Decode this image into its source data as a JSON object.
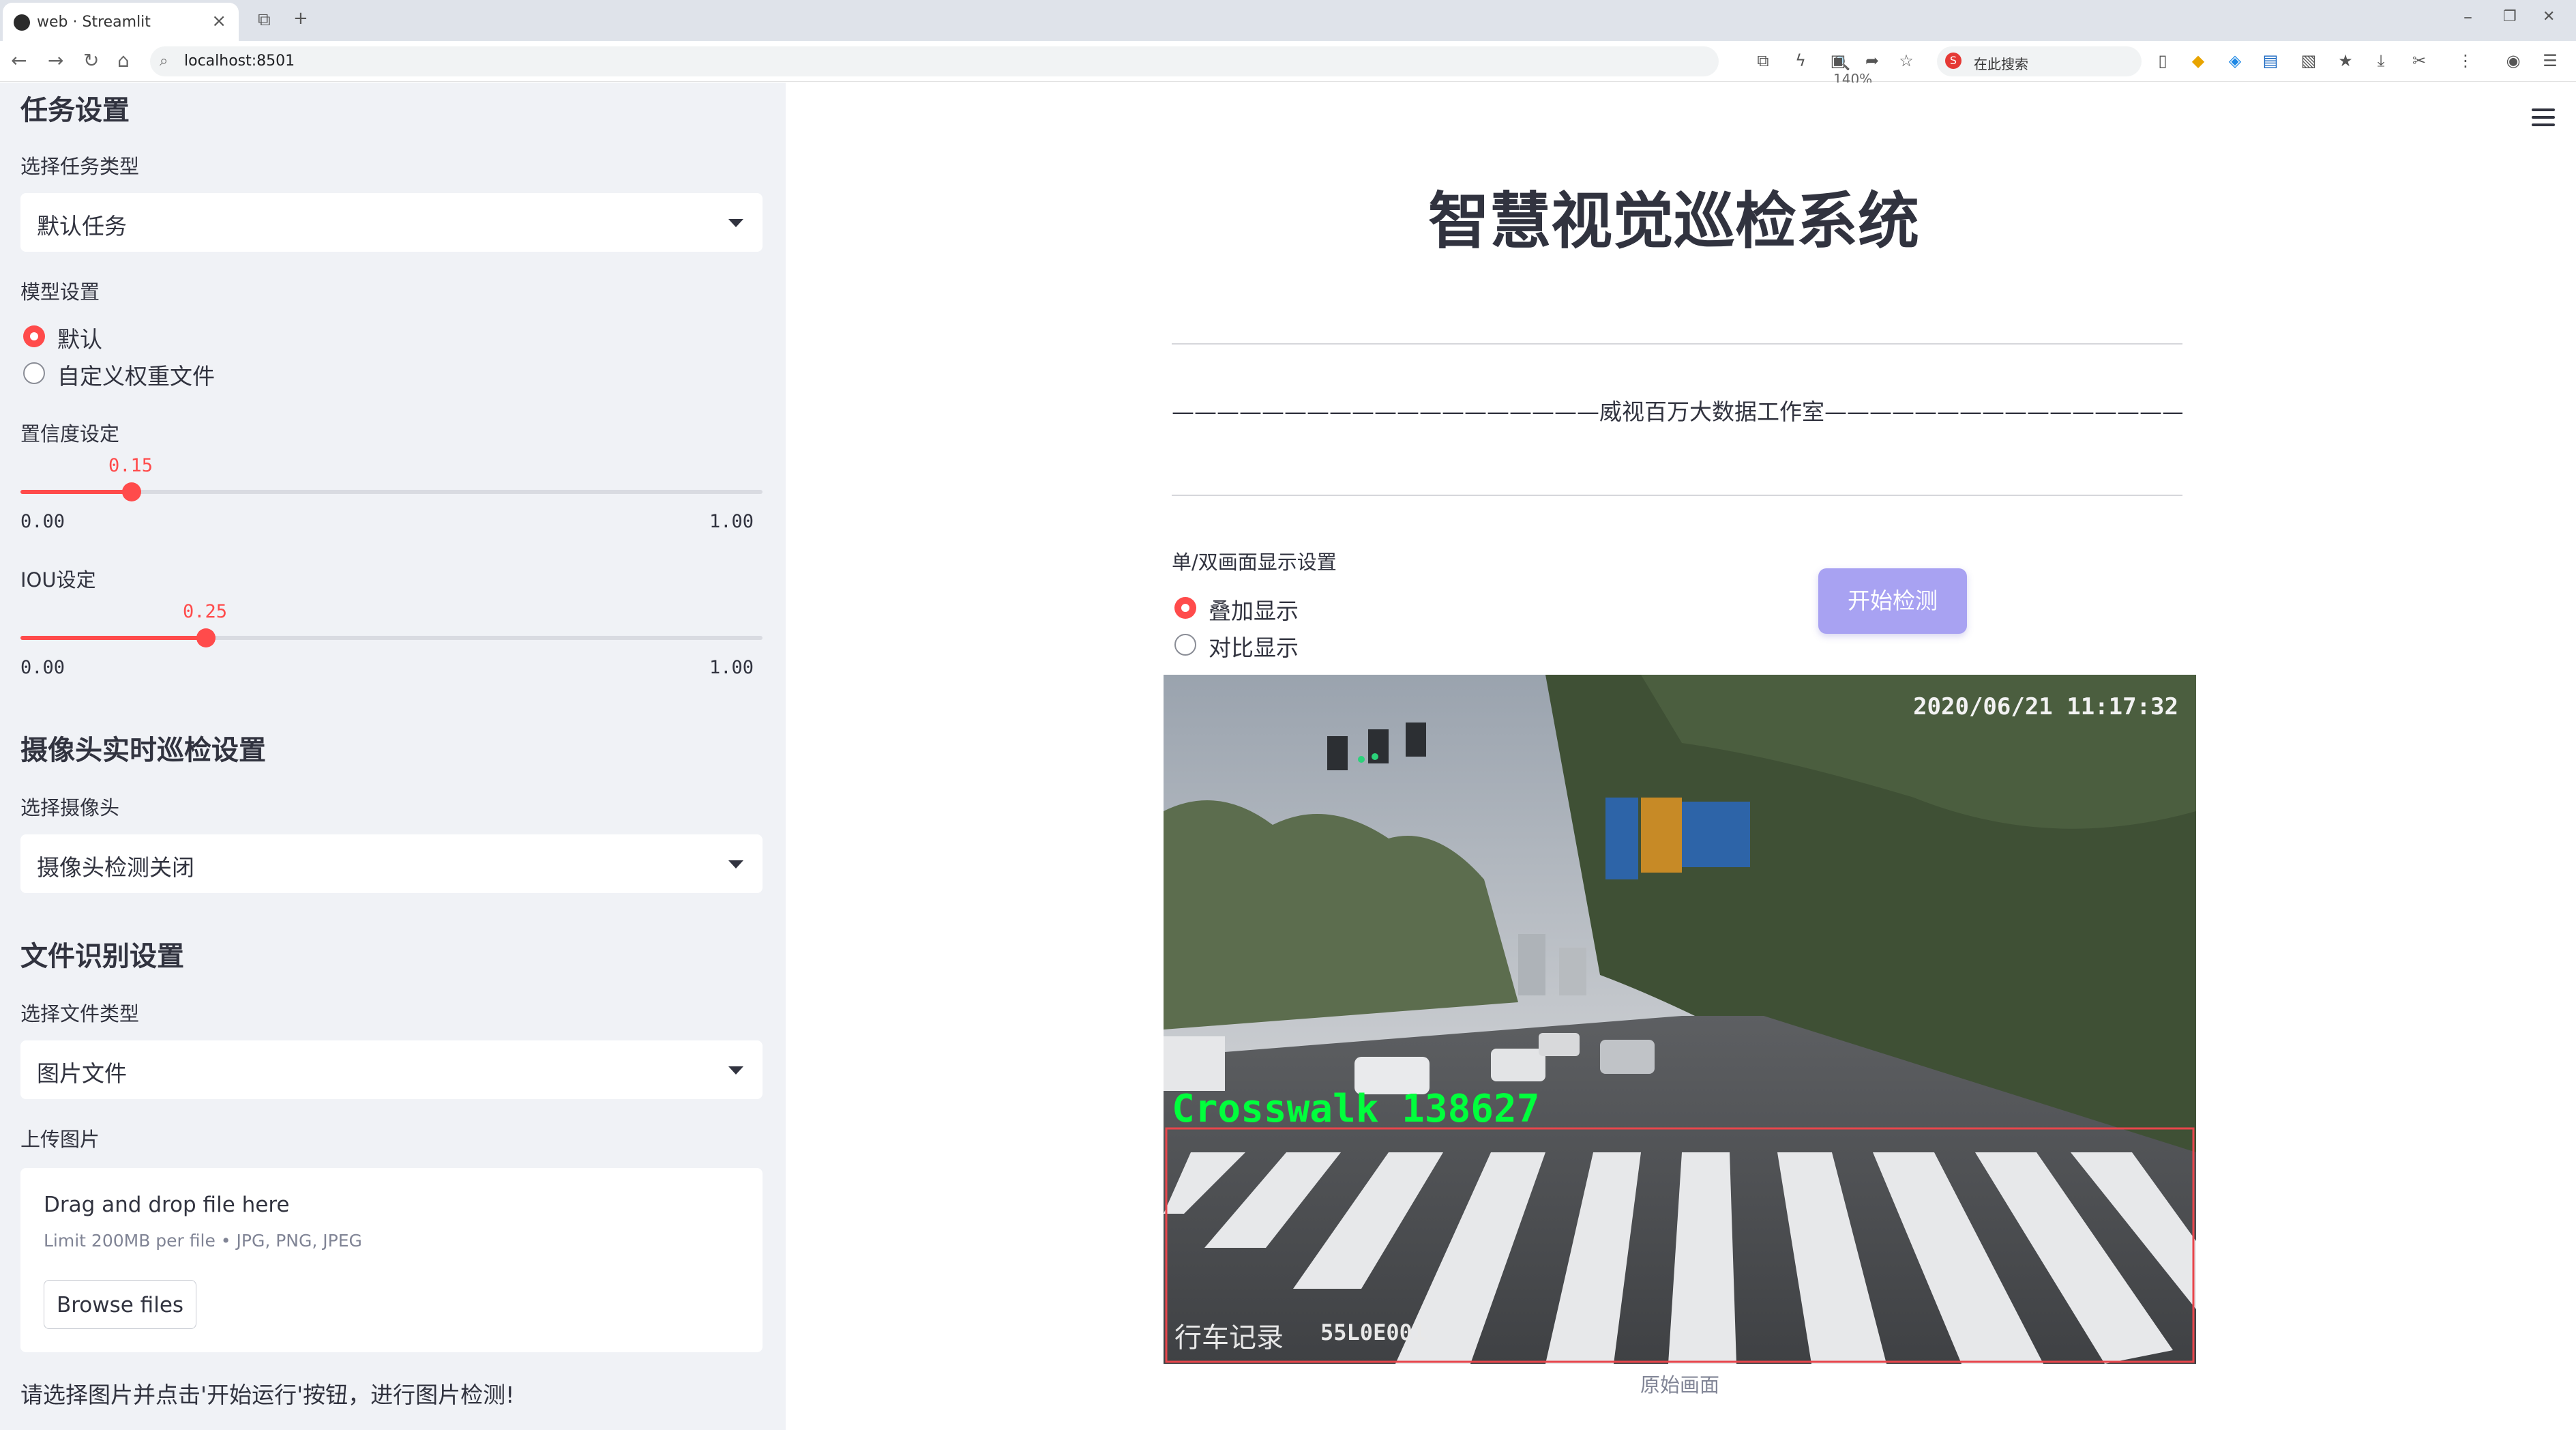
{
  "browser": {
    "tab_title": "web · Streamlit",
    "tab_close": "×",
    "new_tab": "+",
    "url": "localhost:8501",
    "zoom": "140%",
    "search_engine_label": "在此搜索",
    "window_controls": [
      "–",
      "❐",
      "✕"
    ]
  },
  "sidebar": {
    "task_heading": "任务设置",
    "task_type_label": "选择任务类型",
    "task_type_value": "默认任务",
    "model_label": "模型设置",
    "model_options": [
      "默认",
      "自定义权重文件"
    ],
    "model_selected": "默认",
    "conf_label": "置信度设定",
    "conf": {
      "value": "0.15",
      "min": "0.00",
      "max": "1.00",
      "fraction": 0.15
    },
    "iou_label": "IOU设定",
    "iou": {
      "value": "0.25",
      "min": "0.00",
      "max": "1.00",
      "fraction": 0.25
    },
    "camera_heading": "摄像头实时巡检设置",
    "camera_label": "选择摄像头",
    "camera_value": "摄像头检测关闭",
    "file_heading": "文件识别设置",
    "file_type_label": "选择文件类型",
    "file_type_value": "图片文件",
    "upload_label": "上传图片",
    "upload_drag": "Drag and drop file here",
    "upload_limit": "Limit 200MB per file • JPG, PNG, JPEG",
    "browse_label": "Browse files",
    "hint": "请选择图片并点击'开始运行'按钮，进行图片检测!"
  },
  "main": {
    "title": "智慧视觉巡检系统",
    "studio_line": "———————————————————威视百万大数据工作室———————————————————",
    "display_label": "单/双画面显示设置",
    "display_options": [
      "叠加显示",
      "对比显示"
    ],
    "display_selected": "叠加显示",
    "start_button": "开始检测",
    "image": {
      "timestamp": "2020/06/21 11:17:32",
      "detection_label": "Crosswalk 138627",
      "overlay_left": "行车记录",
      "overlay_code": "55L0E001",
      "box_color": "#e8464c",
      "label_color": "#00ff3c"
    },
    "image_caption": "原始画面"
  },
  "colors": {
    "accent": "#ff4b4b",
    "button": "#a8a2f2",
    "sidebar_bg": "#f0f2f6"
  }
}
